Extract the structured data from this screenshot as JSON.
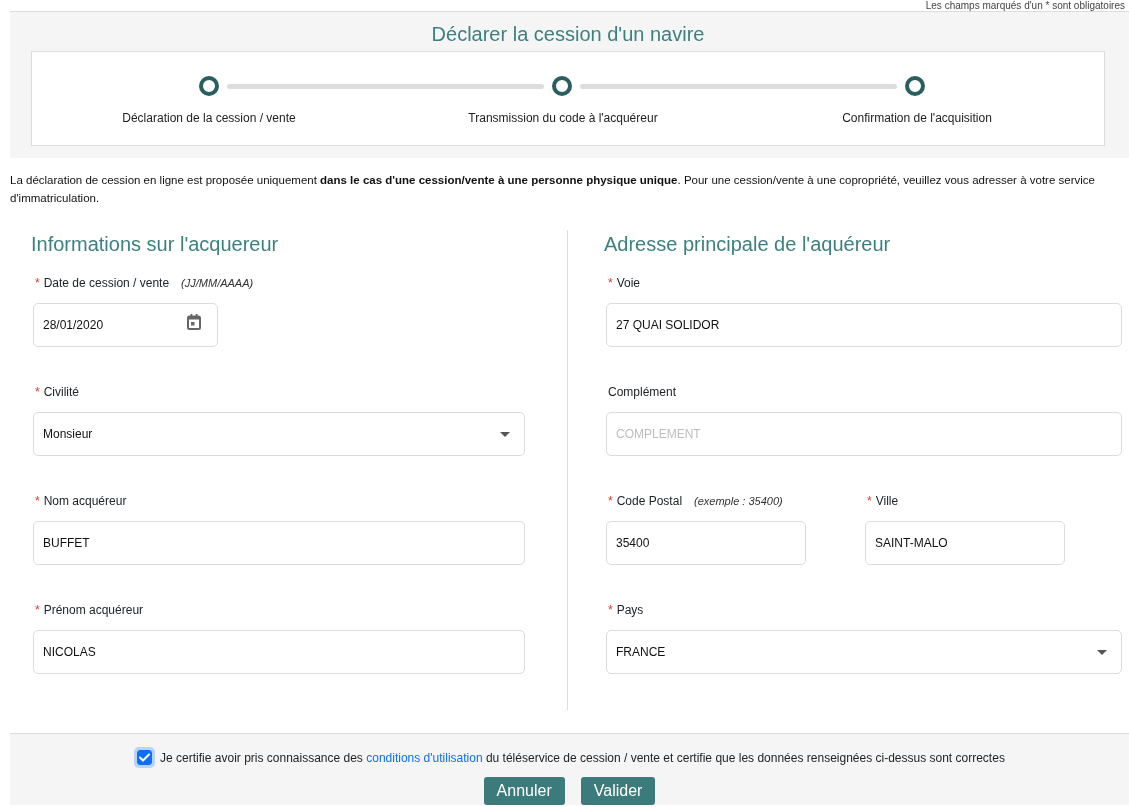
{
  "notice": "Les champs marqués d'un * sont obligatoires",
  "header": {
    "title": "Déclarer la cession d'un navire",
    "steps": [
      {
        "label": "Déclaration de la cession / vente"
      },
      {
        "label": "Transmission du code à l'acquéreur"
      },
      {
        "label": "Confirmation de l'acquisition"
      }
    ]
  },
  "intro": "La déclaration de cession en ligne est proposée uniquement **dans le cas d'une cession/vente à une personne physique unique**. Pour une cession/vente à une copropriété, veuillez vous adresser à votre service d'immatriculation.",
  "required_mark": "*",
  "sections": [
    {
      "heading": "Informations sur l'acquereur",
      "rows": [
        [
          {
            "kind": "date",
            "label": "Date de cession / vente",
            "hint": "(JJ/MM/AAAA)",
            "required": true,
            "value": "28/01/2020"
          }
        ],
        [
          {
            "kind": "select",
            "label": "Civilité",
            "required": true,
            "value": "Monsieur"
          }
        ],
        [
          {
            "kind": "text",
            "label": "Nom acquéreur",
            "required": true,
            "value": "BUFFET"
          }
        ],
        [
          {
            "kind": "text",
            "label": "Prénom acquéreur",
            "required": true,
            "value": "NICOLAS"
          }
        ]
      ]
    },
    {
      "heading": "Adresse principale de l'aquéreur",
      "rows": [
        [
          {
            "kind": "text",
            "label": "Voie",
            "required": true,
            "value": "27 QUAI SOLIDOR"
          }
        ],
        [
          {
            "kind": "text",
            "label": "Complément",
            "required": false,
            "placeholder": "COMPLEMENT"
          }
        ],
        [
          {
            "kind": "text",
            "label": "Code Postal",
            "hint": "(exemple : 35400)",
            "required": true,
            "value": "35400"
          },
          {
            "kind": "text",
            "label": "Ville",
            "required": true,
            "value": "SAINT-MALO"
          }
        ],
        [
          {
            "kind": "select",
            "label": "Pays",
            "required": true,
            "value": "FRANCE"
          }
        ]
      ]
    }
  ],
  "consent": {
    "checked": true,
    "text_before": "Je certifie avoir pris connaissance des ",
    "link": "conditions d'utilisation",
    "text_after": " du téléservice de cession / vente et certifie que les données renseignées ci-dessus sont correctes"
  },
  "buttons": [
    {
      "label": "Annuler"
    },
    {
      "label": "Valider"
    }
  ]
}
